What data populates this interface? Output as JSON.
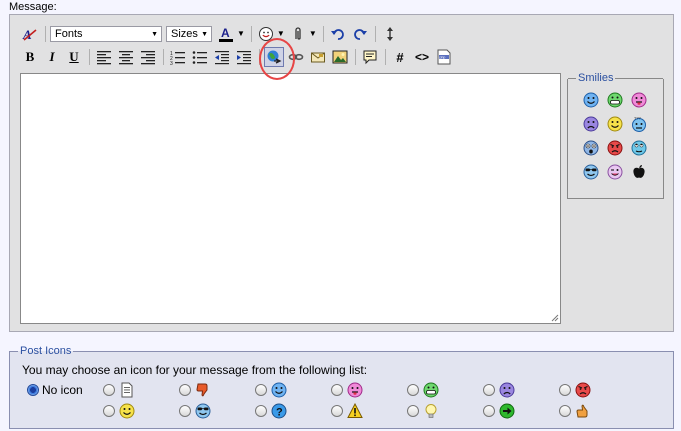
{
  "message_label": "Message:",
  "toolbar": {
    "fonts_value": "Fonts",
    "sizes_value": "Sizes",
    "bold": "B",
    "italic": "I",
    "underline": "U",
    "hash": "#",
    "code": "<>"
  },
  "smilies": {
    "legend": "Smilies"
  },
  "post_icons": {
    "legend": "Post Icons",
    "prompt": "You may choose an icon for your message from the following list:",
    "no_icon_label": "No icon",
    "selected": "no-icon"
  },
  "colors": {
    "accent": "#2a4fa0",
    "highlight_circle": "#e74545",
    "editor_bg": "#e1e1e2",
    "post_bg": "#e2e4f0"
  }
}
